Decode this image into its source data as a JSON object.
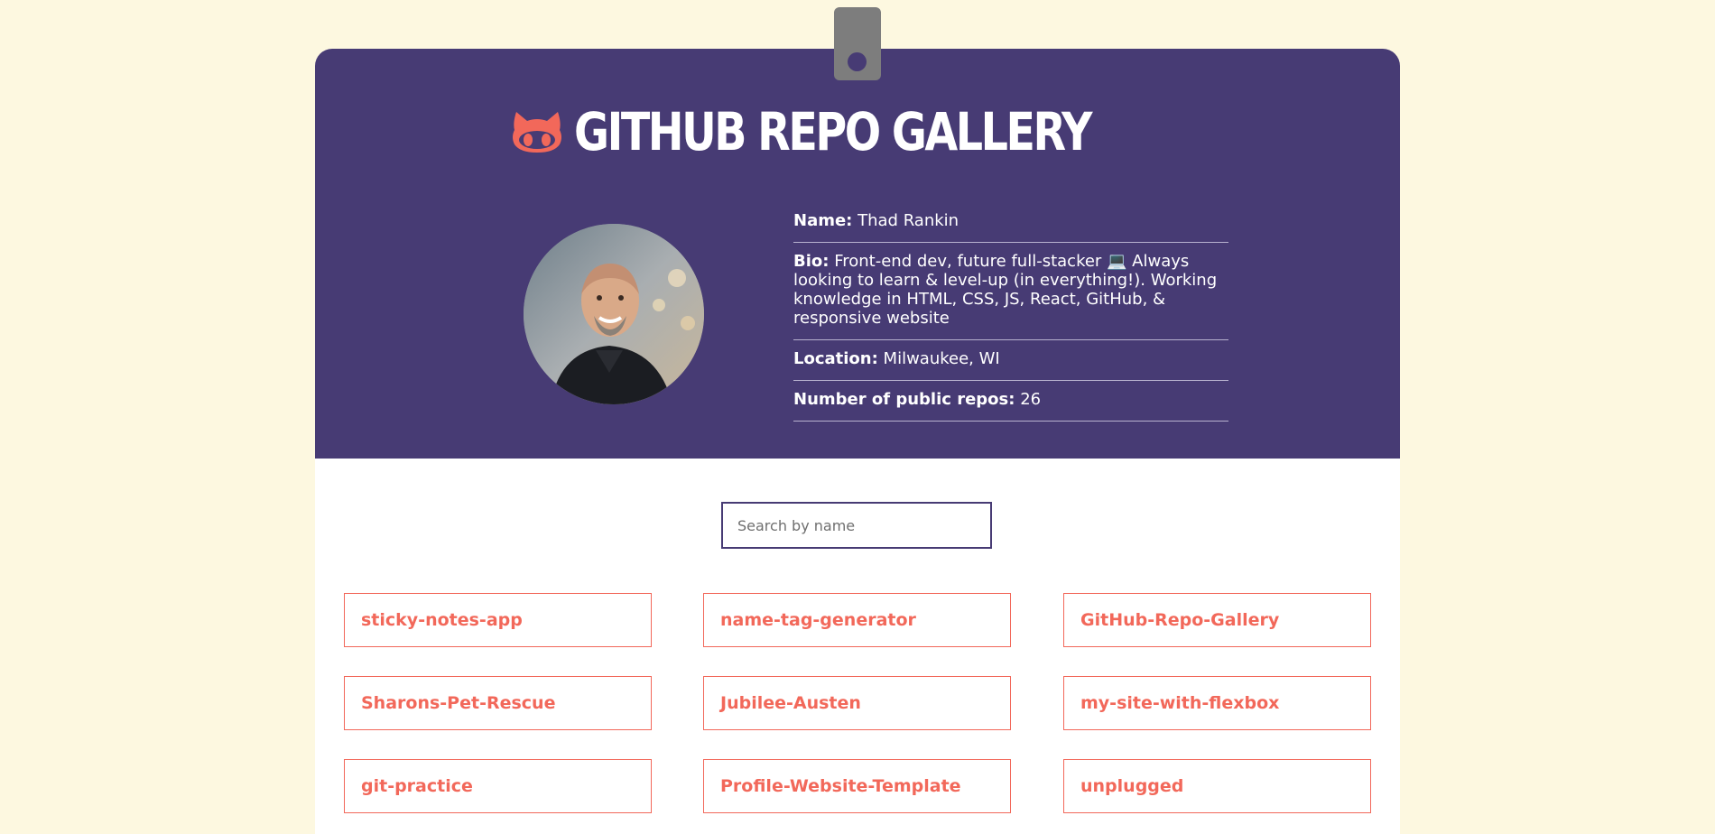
{
  "header": {
    "title": "GITHUB REPO GALLERY",
    "logo_icon": "github-octocat-icon",
    "accent_color": "#f2685a",
    "background_color": "#473b74"
  },
  "profile": {
    "avatar_alt": "Thad Rankin",
    "name_label": "Name:",
    "name": "Thad Rankin",
    "bio_label": "Bio:",
    "bio": "Front-end dev, future full-stacker 💻 Always looking to learn & level-up (in everything!). Working knowledge in HTML, CSS, JS, React, GitHub, & responsive website",
    "location_label": "Location:",
    "location": "Milwaukee, WI",
    "repos_label": "Number of public repos:",
    "repos_count": "26"
  },
  "search": {
    "placeholder": "Search by name",
    "value": ""
  },
  "repos": [
    "sticky-notes-app",
    "name-tag-generator",
    "GitHub-Repo-Gallery",
    "Sharons-Pet-Rescue",
    "Jubilee-Austen",
    "my-site-with-flexbox",
    "git-practice",
    "Profile-Website-Template",
    "unplugged"
  ]
}
